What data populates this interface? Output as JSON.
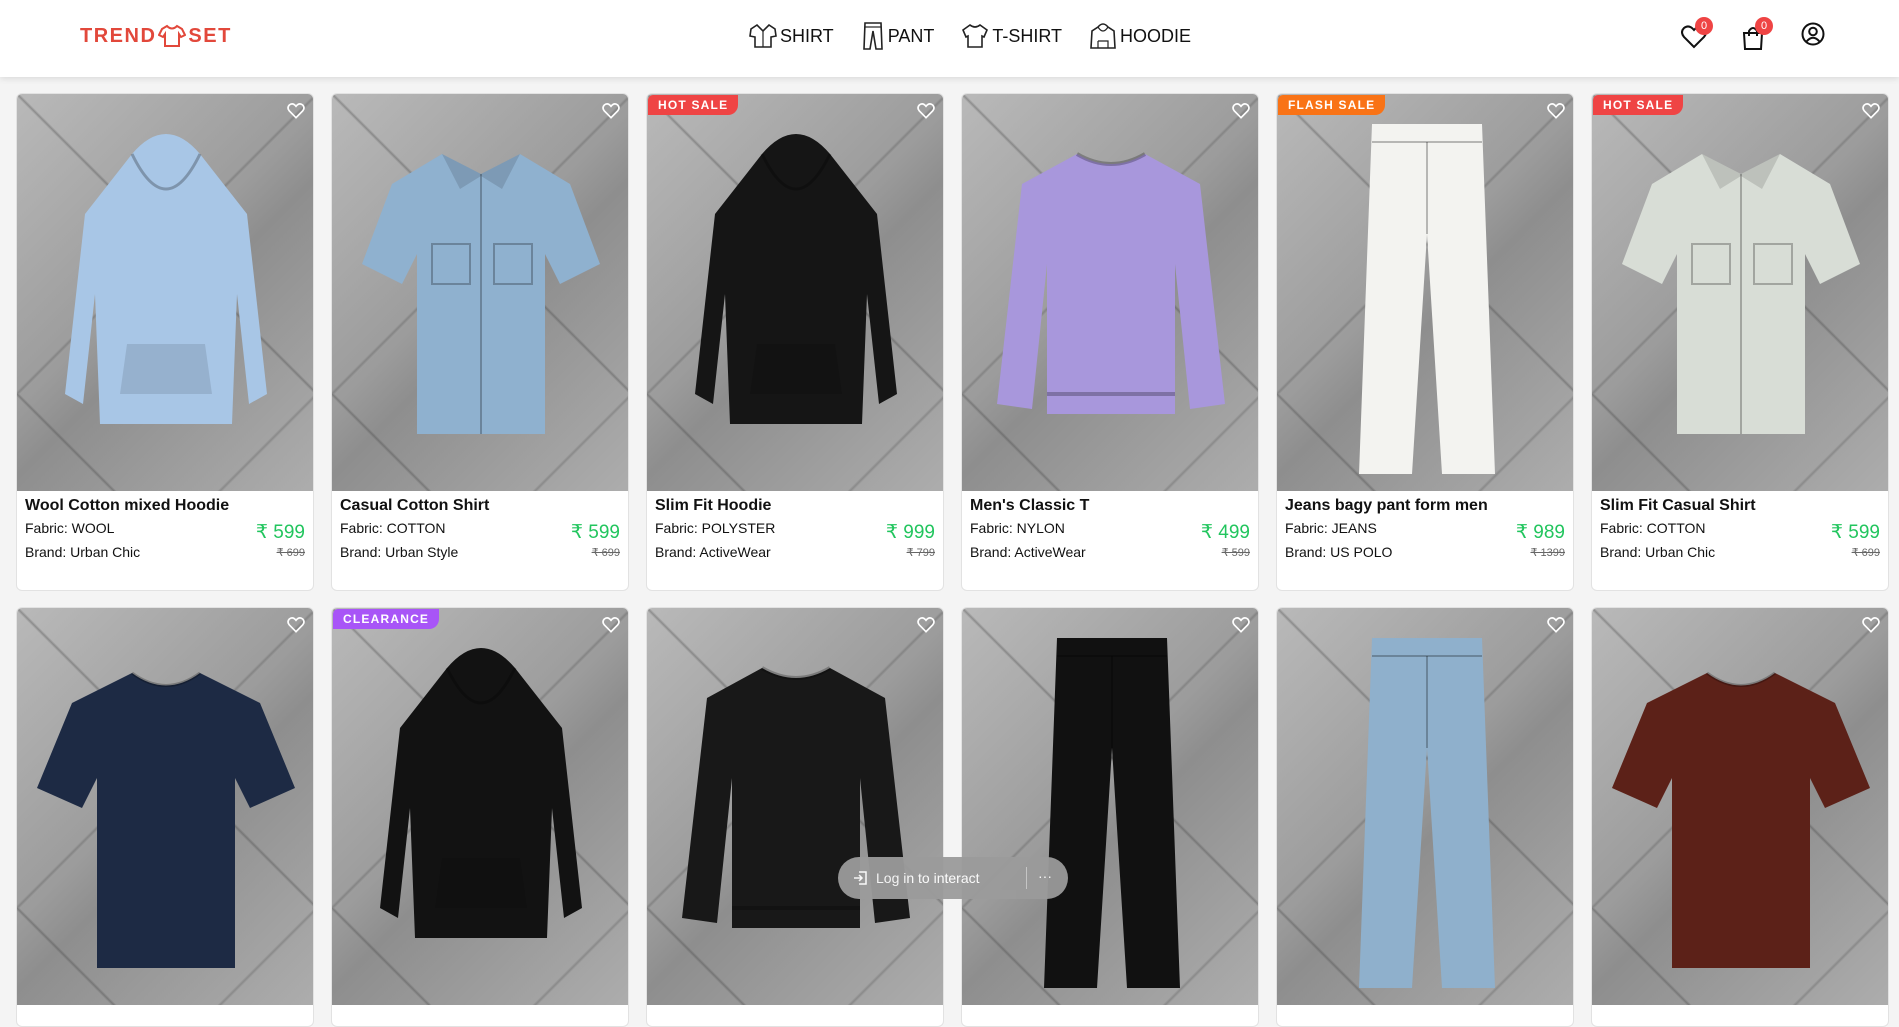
{
  "brand": {
    "left": "TREND",
    "right": "SET"
  },
  "nav": [
    {
      "label": "SHIRT",
      "icon": "shirt-icon"
    },
    {
      "label": "PANT",
      "icon": "pant-icon"
    },
    {
      "label": "T-SHIRT",
      "icon": "tshirt-icon"
    },
    {
      "label": "HOODIE",
      "icon": "hoodie-icon"
    }
  ],
  "header_icons": {
    "wishlist_count": "0",
    "cart_count": "0"
  },
  "colors": {
    "accent": "#e2483b",
    "price": "#22c55e",
    "hot_sale": "#ef4444",
    "flash_sale": "#f97316",
    "clearance": "#a855f7"
  },
  "products": [
    {
      "name": "Wool Cotton mixed Hoodie",
      "fabric": "Fabric: WOOL",
      "brand": "Brand: Urban Chic",
      "price": "₹ 599",
      "old_price": "₹ 699",
      "tag": "",
      "garment": "hoodie",
      "color": "#a8c6e6"
    },
    {
      "name": "Casual Cotton Shirt",
      "fabric": "Fabric: COTTON",
      "brand": "Brand: Urban Style",
      "price": "₹ 599",
      "old_price": "₹ 699",
      "tag": "",
      "garment": "shirt",
      "color": "#8fb1cf"
    },
    {
      "name": "Slim Fit Hoodie",
      "fabric": "Fabric: POLYSTER",
      "brand": "Brand: ActiveWear",
      "price": "₹ 999",
      "old_price": "₹ 799",
      "tag": "HOT SALE",
      "garment": "hoodie",
      "color": "#151515"
    },
    {
      "name": "Men's Classic T",
      "fabric": "Fabric: NYLON",
      "brand": "Brand: ActiveWear",
      "price": "₹ 499",
      "old_price": "₹ 599",
      "tag": "",
      "garment": "sweat",
      "color": "#a897dc"
    },
    {
      "name": "Jeans bagy pant form men",
      "fabric": "Fabric: JEANS",
      "brand": "Brand: US POLO",
      "price": "₹ 989",
      "old_price": "₹ 1399",
      "tag": "FLASH SALE",
      "garment": "pant",
      "color": "#f3f3f0"
    },
    {
      "name": "Slim Fit Casual Shirt",
      "fabric": "Fabric: COTTON",
      "brand": "Brand: Urban Chic",
      "price": "₹ 599",
      "old_price": "₹ 699",
      "tag": "HOT SALE",
      "garment": "shirt",
      "color": "#d8ddd6"
    },
    {
      "name": "",
      "fabric": "",
      "brand": "",
      "price": "",
      "old_price": "",
      "tag": "",
      "garment": "tshirt",
      "color": "#1d2a44"
    },
    {
      "name": "",
      "fabric": "",
      "brand": "",
      "price": "",
      "old_price": "",
      "tag": "CLEARANCE",
      "garment": "hoodie",
      "color": "#121212"
    },
    {
      "name": "",
      "fabric": "",
      "brand": "",
      "price": "",
      "old_price": "",
      "tag": "",
      "garment": "sweat",
      "color": "#181818"
    },
    {
      "name": "",
      "fabric": "",
      "brand": "",
      "price": "",
      "old_price": "",
      "tag": "",
      "garment": "pant",
      "color": "#111111"
    },
    {
      "name": "",
      "fabric": "",
      "brand": "",
      "price": "",
      "old_price": "",
      "tag": "",
      "garment": "pant",
      "color": "#8fb0cc"
    },
    {
      "name": "",
      "fabric": "",
      "brand": "",
      "price": "",
      "old_price": "",
      "tag": "",
      "garment": "tshirt",
      "color": "#5c2118"
    }
  ],
  "login_prompt": {
    "label": "Log in to interact",
    "more": "···"
  }
}
